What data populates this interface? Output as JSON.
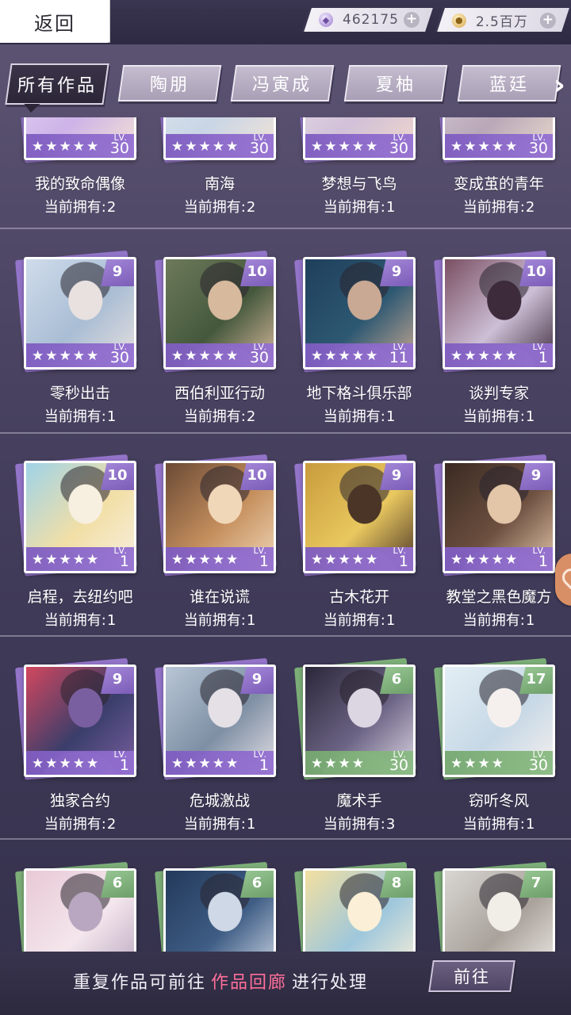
{
  "header": {
    "back_label": "返回",
    "diamonds": {
      "value": "462175",
      "icon": "diamond-icon",
      "plus": "+"
    },
    "gold": {
      "value": "2.5百万",
      "icon": "gold-coin-icon",
      "plus": "+"
    }
  },
  "tabs": [
    {
      "label": "所有作品",
      "active": true
    },
    {
      "label": "陶朋",
      "active": false
    },
    {
      "label": "冯寅成",
      "active": false
    },
    {
      "label": "夏柚",
      "active": false
    },
    {
      "label": "蓝廷",
      "active": false
    }
  ],
  "tab_next_icon": "chevron-right-icon",
  "owned_prefix": "当前拥有:",
  "lv_label": "LV.",
  "star_glyph": "★",
  "colors": {
    "purple": "#8f70c8",
    "green": "#7aac76",
    "highlight": "#ff6e9a"
  },
  "rows": [
    [
      {
        "title": "我的致命偶像",
        "owned": "2",
        "level": "30",
        "badge": "",
        "color": "purple",
        "stars": 5
      },
      {
        "title": "南海",
        "owned": "2",
        "level": "30",
        "badge": "",
        "color": "purple",
        "stars": 5
      },
      {
        "title": "梦想与飞鸟",
        "owned": "1",
        "level": "30",
        "badge": "",
        "color": "purple",
        "stars": 5
      },
      {
        "title": "变成茧的青年",
        "owned": "2",
        "level": "30",
        "badge": "",
        "color": "purple",
        "stars": 5
      }
    ],
    [
      {
        "title": "零秒出击",
        "owned": "1",
        "level": "30",
        "badge": "9",
        "color": "purple",
        "stars": 5
      },
      {
        "title": "西伯利亚行动",
        "owned": "2",
        "level": "30",
        "badge": "10",
        "color": "purple",
        "stars": 5
      },
      {
        "title": "地下格斗俱乐部",
        "owned": "1",
        "level": "11",
        "badge": "9",
        "color": "purple",
        "stars": 5
      },
      {
        "title": "谈判专家",
        "owned": "1",
        "level": "1",
        "badge": "10",
        "color": "purple",
        "stars": 5
      }
    ],
    [
      {
        "title": "启程，去纽约吧",
        "owned": "1",
        "level": "1",
        "badge": "10",
        "color": "purple",
        "stars": 5
      },
      {
        "title": "谁在说谎",
        "owned": "1",
        "level": "1",
        "badge": "10",
        "color": "purple",
        "stars": 5
      },
      {
        "title": "古木花开",
        "owned": "1",
        "level": "1",
        "badge": "9",
        "color": "purple",
        "stars": 5
      },
      {
        "title": "教堂之黑色魔方",
        "owned": "1",
        "level": "1",
        "badge": "9",
        "color": "purple",
        "stars": 5
      }
    ],
    [
      {
        "title": "独家合约",
        "owned": "2",
        "level": "1",
        "badge": "9",
        "color": "purple",
        "stars": 5
      },
      {
        "title": "危城激战",
        "owned": "1",
        "level": "1",
        "badge": "9",
        "color": "purple",
        "stars": 5
      },
      {
        "title": "魔术手",
        "owned": "3",
        "level": "30",
        "badge": "6",
        "color": "green",
        "stars": 4
      },
      {
        "title": "窃听冬风",
        "owned": "1",
        "level": "30",
        "badge": "17",
        "color": "green",
        "stars": 4
      }
    ],
    [
      {
        "title": "",
        "owned": "",
        "level": "",
        "badge": "6",
        "color": "green",
        "stars": 0
      },
      {
        "title": "",
        "owned": "",
        "level": "",
        "badge": "6",
        "color": "green",
        "stars": 0
      },
      {
        "title": "",
        "owned": "",
        "level": "",
        "badge": "8",
        "color": "green",
        "stars": 0
      },
      {
        "title": "",
        "owned": "",
        "level": "",
        "badge": "7",
        "color": "green",
        "stars": 0
      }
    ]
  ],
  "bottom": {
    "hint_before": "重复作品可前往",
    "hint_link": "作品回廊",
    "hint_after": "进行处理",
    "go_label": "前往"
  }
}
